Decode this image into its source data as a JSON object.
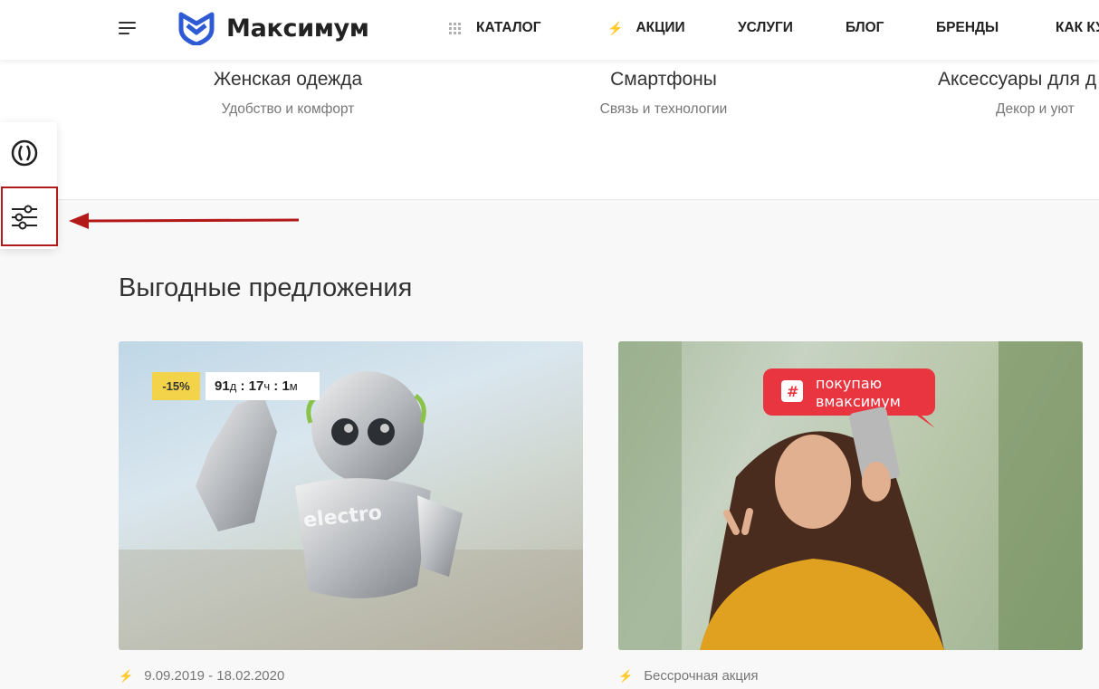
{
  "header": {
    "logo_text": "Максимум",
    "nav": [
      {
        "label": "КАТАЛОГ",
        "icon": "grid-dots-icon"
      },
      {
        "label": "АКЦИИ",
        "icon": "lightning-icon"
      },
      {
        "label": "УСЛУГИ"
      },
      {
        "label": "БЛОГ"
      },
      {
        "label": "БРЕНДЫ"
      },
      {
        "label": "КАК КУ"
      }
    ]
  },
  "categories": [
    {
      "name": "Женская одежда",
      "subtitle": "Удобство и комфорт"
    },
    {
      "name": "Смартфоны",
      "subtitle": "Связь и технологии"
    },
    {
      "name": "Аксессуары для д",
      "subtitle": "Декор и уют"
    }
  ],
  "side_panel": {
    "buttons": [
      {
        "icon": "theme-circle-icon"
      },
      {
        "icon": "settings-sliders-icon"
      }
    ]
  },
  "offers": {
    "title": "Выгодные предложения",
    "cards": [
      {
        "discount": "-15%",
        "timer": {
          "days": "91",
          "days_unit": "д",
          "hours": "17",
          "hours_unit": "ч",
          "minutes": "1",
          "minutes_unit": "м"
        },
        "image_text": "electro",
        "date": "9.09.2019 - 18.02.2020",
        "bolt_color": "#e03b3b"
      },
      {
        "banner_line1": "покупаю",
        "banner_line2": "вмаксимум",
        "date": "Бессрочная акция",
        "bolt_color": "#999999"
      }
    ]
  },
  "colors": {
    "accent": "#2e5bd4",
    "highlight_red": "#b21a1a",
    "badge_yellow": "#f3d34a",
    "banner_red": "#e8353f"
  }
}
